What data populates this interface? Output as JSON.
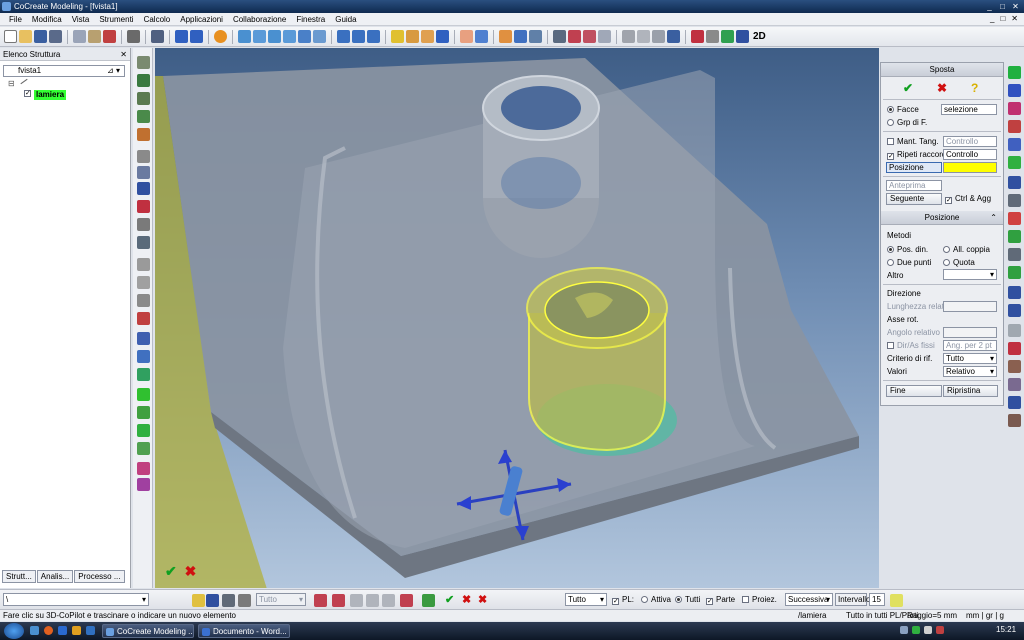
{
  "window": {
    "title": "CoCreate Modeling - [fvista1]",
    "controls": [
      "_",
      "□",
      "✕"
    ],
    "doc_controls": [
      "_",
      "□",
      "✕"
    ]
  },
  "menu": [
    "File",
    "Modifica",
    "Vista",
    "Strumenti",
    "Calcolo",
    "Applicazioni",
    "Collaborazione",
    "Finestra",
    "Guida"
  ],
  "toolbar": {
    "view_2d_label": "2D"
  },
  "structure_panel": {
    "title": "Elenco Struttura",
    "close": "✕",
    "root_view": "fvista1",
    "tree_node": "lamiera",
    "tabs": [
      "Strutt...",
      "Analis...",
      "Processo ..."
    ]
  },
  "viewport": {
    "ok_mark": "✔",
    "cancel_mark": "✖"
  },
  "sposta_panel": {
    "title": "Sposta",
    "buttons": {
      "ok": "✔",
      "cancel": "✖",
      "help": "?"
    },
    "facce_label": "Facce",
    "facce_value": "selezione",
    "grp_label": "Grp di F.",
    "mant_tang_label": "Mant. Tang.",
    "mant_tang_value": "Controllo",
    "ripeti_label": "Ripeti raccordi",
    "ripeti_value": "Controllo",
    "posizione_label": "Posizione",
    "anteprima_label": "Anteprima",
    "seguente_label": "Seguente",
    "ctrl_agg_label": "Ctrl & Agg",
    "posizione_section": "Posizione",
    "metodi_label": "Metodi",
    "pos_din_label": "Pos. din.",
    "all_coppia_label": "All. coppia",
    "due_punti_label": "Due punti",
    "quota_label": "Quota",
    "altro_label": "Altro",
    "direzione_label": "Direzione",
    "lunghezza_label": "Lunghezza relativa",
    "asse_rot_label": "Asse rot.",
    "angolo_label": "Angolo relativo",
    "dir_as_label": "Dir/As fissi",
    "ang_2pt_value": "Ang. per 2 pt",
    "criterio_label": "Criterio di rif.",
    "criterio_value": "Tutto",
    "valori_label": "Valori",
    "valori_value": "Relativo",
    "fine_label": "Fine",
    "ripristina_label": "Ripristina"
  },
  "bottom_bar": {
    "command_input": "\\",
    "tutto_select": "Tutto",
    "filter_select": "Tutto",
    "pl_label": "PL:",
    "attiva_label": "Attiva",
    "tutti_label": "Tutti",
    "parte_label": "Parte",
    "proiez_label": "Proiez.",
    "successiva_select": "Successiva",
    "intervallo_label": "Intervallo",
    "intervallo_value": "15"
  },
  "status": {
    "message": "Fare clic su 3D-CoPilot e trascinare o indicare un nuovo elemento",
    "part": "/lamiera",
    "scope": "Tutto in tutti PL/Parti",
    "radius": "Raggio=5 mm",
    "units": "mm | gr | g"
  },
  "taskbar": {
    "tasks": [
      "CoCreate Modeling ...",
      "Documento - Word..."
    ],
    "clock": "15:21"
  },
  "colors": {
    "highlight_green": "#33ff33",
    "selection_yellow": "#ffff00",
    "accent_blue": "#2a4f80"
  }
}
